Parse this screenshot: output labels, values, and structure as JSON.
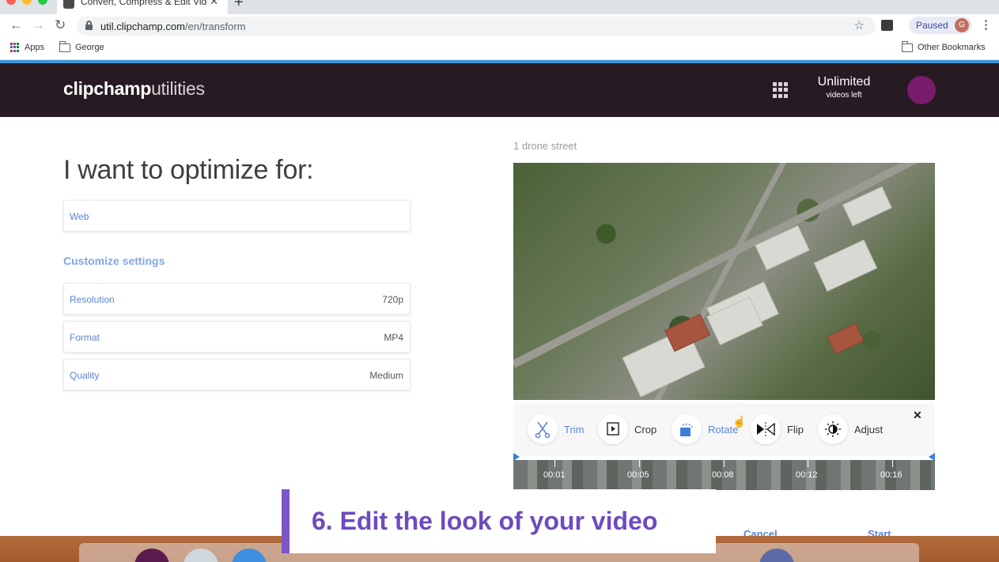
{
  "browser": {
    "tab_title": "Convert, Compress & Edit Vide",
    "url_host": "util.clipchamp.com",
    "url_path": "/en/transform",
    "paused_label": "Paused",
    "profile_initial": "G",
    "bookmarks": [
      "Apps",
      "George"
    ],
    "other_bookmarks": "Other Bookmarks"
  },
  "app": {
    "logo_bold": "clipchamp",
    "logo_light": "utilities",
    "plan_title": "Unlimited",
    "plan_sub": "videos left",
    "avatar_color": "#7a1b6c"
  },
  "optimize": {
    "heading": "I want to optimize for:",
    "selected": "Web",
    "customize_label": "Customize settings",
    "settings": [
      {
        "label": "Resolution",
        "value": "720p"
      },
      {
        "label": "Format",
        "value": "MP4"
      },
      {
        "label": "Quality",
        "value": "Medium"
      }
    ]
  },
  "video": {
    "title": "1 drone street"
  },
  "tools": [
    {
      "label": "Trim",
      "active": true
    },
    {
      "label": "Crop",
      "active": false
    },
    {
      "label": "Rotate",
      "active": true
    },
    {
      "label": "Flip",
      "active": false
    },
    {
      "label": "Adjust",
      "active": false
    }
  ],
  "timeline": {
    "ticks": [
      "00:01",
      "00:05",
      "00:08",
      "00:12",
      "00:16"
    ]
  },
  "actions": {
    "cancel": "Cancel",
    "start": "Start"
  },
  "caption": "6. Edit the look of your video",
  "colors": {
    "accent": "#5b84d6",
    "header_bg": "#271a23",
    "caption_purple": "#6c4bbf"
  }
}
